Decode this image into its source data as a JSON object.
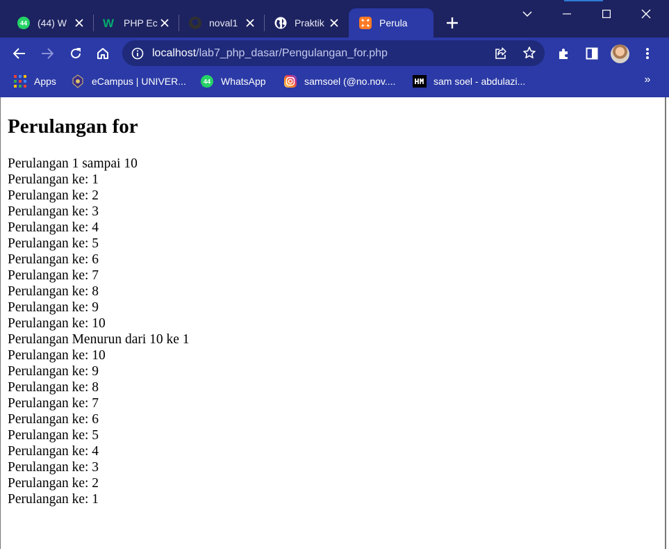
{
  "browser": {
    "tabs": [
      {
        "title": "(44) W",
        "icon": "whatsapp-icon",
        "active": false
      },
      {
        "title": "PHP Ec",
        "icon": "w3-icon",
        "active": false
      },
      {
        "title": "noval1",
        "icon": "github-icon",
        "active": false
      },
      {
        "title": "Praktik",
        "icon": "globe-icon",
        "active": false
      },
      {
        "title": "Perula",
        "icon": "xampp-icon",
        "active": true
      }
    ],
    "whatsapp_badge": "44",
    "address": {
      "host": "localhost",
      "path": "/lab7_php_dasar/Pengulangan_for.php"
    },
    "bookmarks": [
      {
        "label": "Apps",
        "icon": "apps-grid-icon"
      },
      {
        "label": "eCampus | UNIVER...",
        "icon": "university-icon"
      },
      {
        "label": "WhatsApp",
        "icon": "whatsapp-icon"
      },
      {
        "label": "samsoel (@no.nov....",
        "icon": "instagram-icon"
      },
      {
        "label": "sam soel - abdulazi...",
        "icon": "hackmd-icon"
      }
    ],
    "bookmarks_more": "»",
    "colors": {
      "frame": "#1d2260",
      "toolbar": "#2b3aa6",
      "accent": "#2d7bd6"
    }
  },
  "page": {
    "title": "Perulangan for",
    "lines": [
      "Perulangan 1 sampai 10",
      "Perulangan ke: 1",
      "Perulangan ke: 2",
      "Perulangan ke: 3",
      "Perulangan ke: 4",
      "Perulangan ke: 5",
      "Perulangan ke: 6",
      "Perulangan ke: 7",
      "Perulangan ke: 8",
      "Perulangan ke: 9",
      "Perulangan ke: 10",
      "Perulangan Menurun dari 10 ke 1",
      "Perulangan ke: 10",
      "Perulangan ke: 9",
      "Perulangan ke: 8",
      "Perulangan ke: 7",
      "Perulangan ke: 6",
      "Perulangan ke: 5",
      "Perulangan ke: 4",
      "Perulangan ke: 3",
      "Perulangan ke: 2",
      "Perulangan ke: 1"
    ]
  }
}
